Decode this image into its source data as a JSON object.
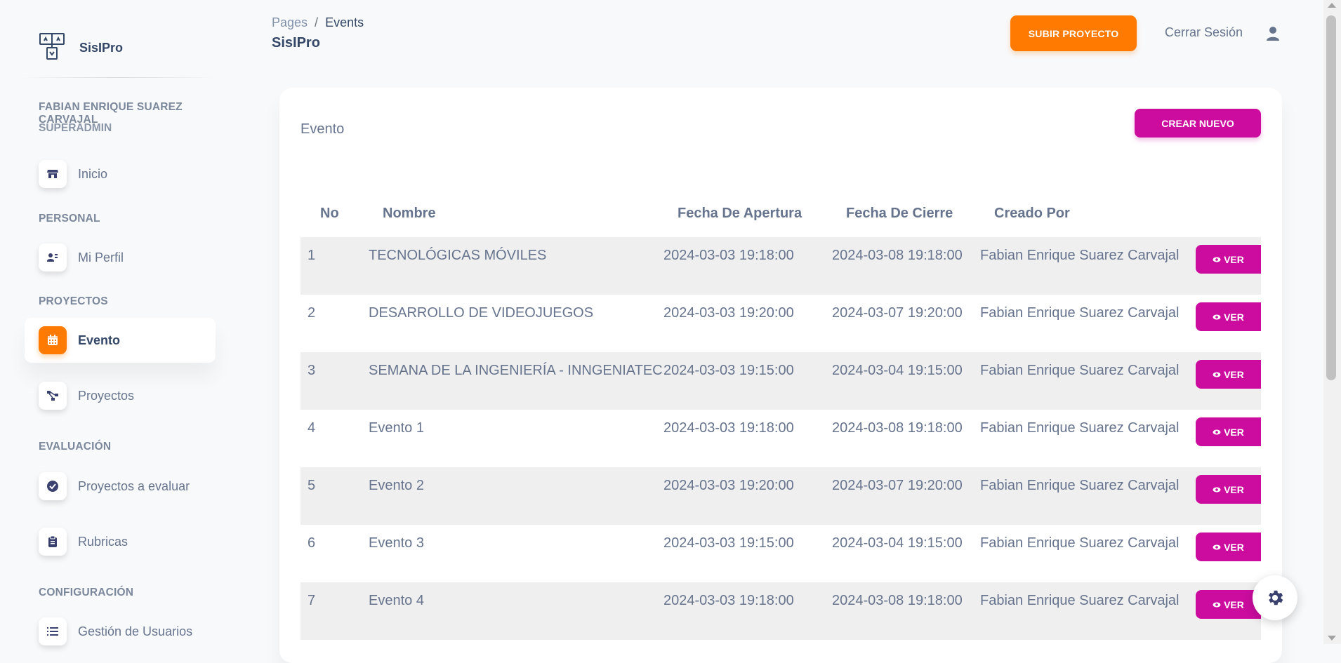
{
  "brand": {
    "name": "SisIPro",
    "icon": "sitemap-logo-icon"
  },
  "user": {
    "name": "FABIAN ENRIQUE SUAREZ CARVAJAL",
    "role": "SUPERADMIN"
  },
  "sidebar": {
    "sections": [
      {
        "label": "PERSONAL"
      },
      {
        "label": "PROYECTOS"
      },
      {
        "label": "EVALUACIÓN"
      },
      {
        "label": "CONFIGURACIÓN"
      }
    ],
    "items": [
      {
        "label": "Inicio",
        "icon": "shop-icon"
      },
      {
        "label": "Mi Perfil",
        "icon": "profile-icon"
      },
      {
        "label": "Evento",
        "icon": "calendar-icon",
        "active": true
      },
      {
        "label": "Proyectos",
        "icon": "diagram-icon"
      },
      {
        "label": "Proyectos a evaluar",
        "icon": "check-circle-icon"
      },
      {
        "label": "Rubricas",
        "icon": "clipboard-icon"
      },
      {
        "label": "Gestión de Usuarios",
        "icon": "list-icon"
      }
    ]
  },
  "header": {
    "breadcrumb": {
      "parent": "Pages",
      "separator": "/",
      "current": "Events"
    },
    "title": "SisIPro",
    "upload_button": "SUBIR PROYECTO",
    "logout": "Cerrar Sesión"
  },
  "card": {
    "title": "Evento",
    "create_button": "CREAR NUEVO",
    "columns": [
      "No",
      "Nombre",
      "Fecha De Apertura",
      "Fecha De Cierre",
      "Creado Por"
    ],
    "view_label": "VER",
    "rows": [
      {
        "no": "1",
        "nombre": "TECNOLÓGICAS MÓVILES",
        "apertura": "2024-03-03 19:18:00",
        "cierre": "2024-03-08 19:18:00",
        "creado": "Fabian Enrique Suarez Carvajal"
      },
      {
        "no": "2",
        "nombre": "DESARROLLO DE VIDEOJUEGOS",
        "apertura": "2024-03-03 19:20:00",
        "cierre": "2024-03-07 19:20:00",
        "creado": "Fabian Enrique Suarez Carvajal"
      },
      {
        "no": "3",
        "nombre": "SEMANA DE LA INGENIERÍA - INNGENIATEC",
        "apertura": "2024-03-03 19:15:00",
        "cierre": "2024-03-04 19:15:00",
        "creado": "Fabian Enrique Suarez Carvajal"
      },
      {
        "no": "4",
        "nombre": "Evento 1",
        "apertura": "2024-03-03 19:18:00",
        "cierre": "2024-03-08 19:18:00",
        "creado": "Fabian Enrique Suarez Carvajal"
      },
      {
        "no": "5",
        "nombre": "Evento 2",
        "apertura": "2024-03-03 19:20:00",
        "cierre": "2024-03-07 19:20:00",
        "creado": "Fabian Enrique Suarez Carvajal"
      },
      {
        "no": "6",
        "nombre": "Evento 3",
        "apertura": "2024-03-03 19:15:00",
        "cierre": "2024-03-04 19:15:00",
        "creado": "Fabian Enrique Suarez Carvajal"
      },
      {
        "no": "7",
        "nombre": "Evento 4",
        "apertura": "2024-03-03 19:18:00",
        "cierre": "2024-03-08 19:18:00",
        "creado": "Fabian Enrique Suarez Carvajal"
      }
    ]
  },
  "colors": {
    "accent_orange": "#ff7a00",
    "accent_pink": "#cb0c9f",
    "text_dark": "#344767",
    "text_muted": "#67748e"
  }
}
